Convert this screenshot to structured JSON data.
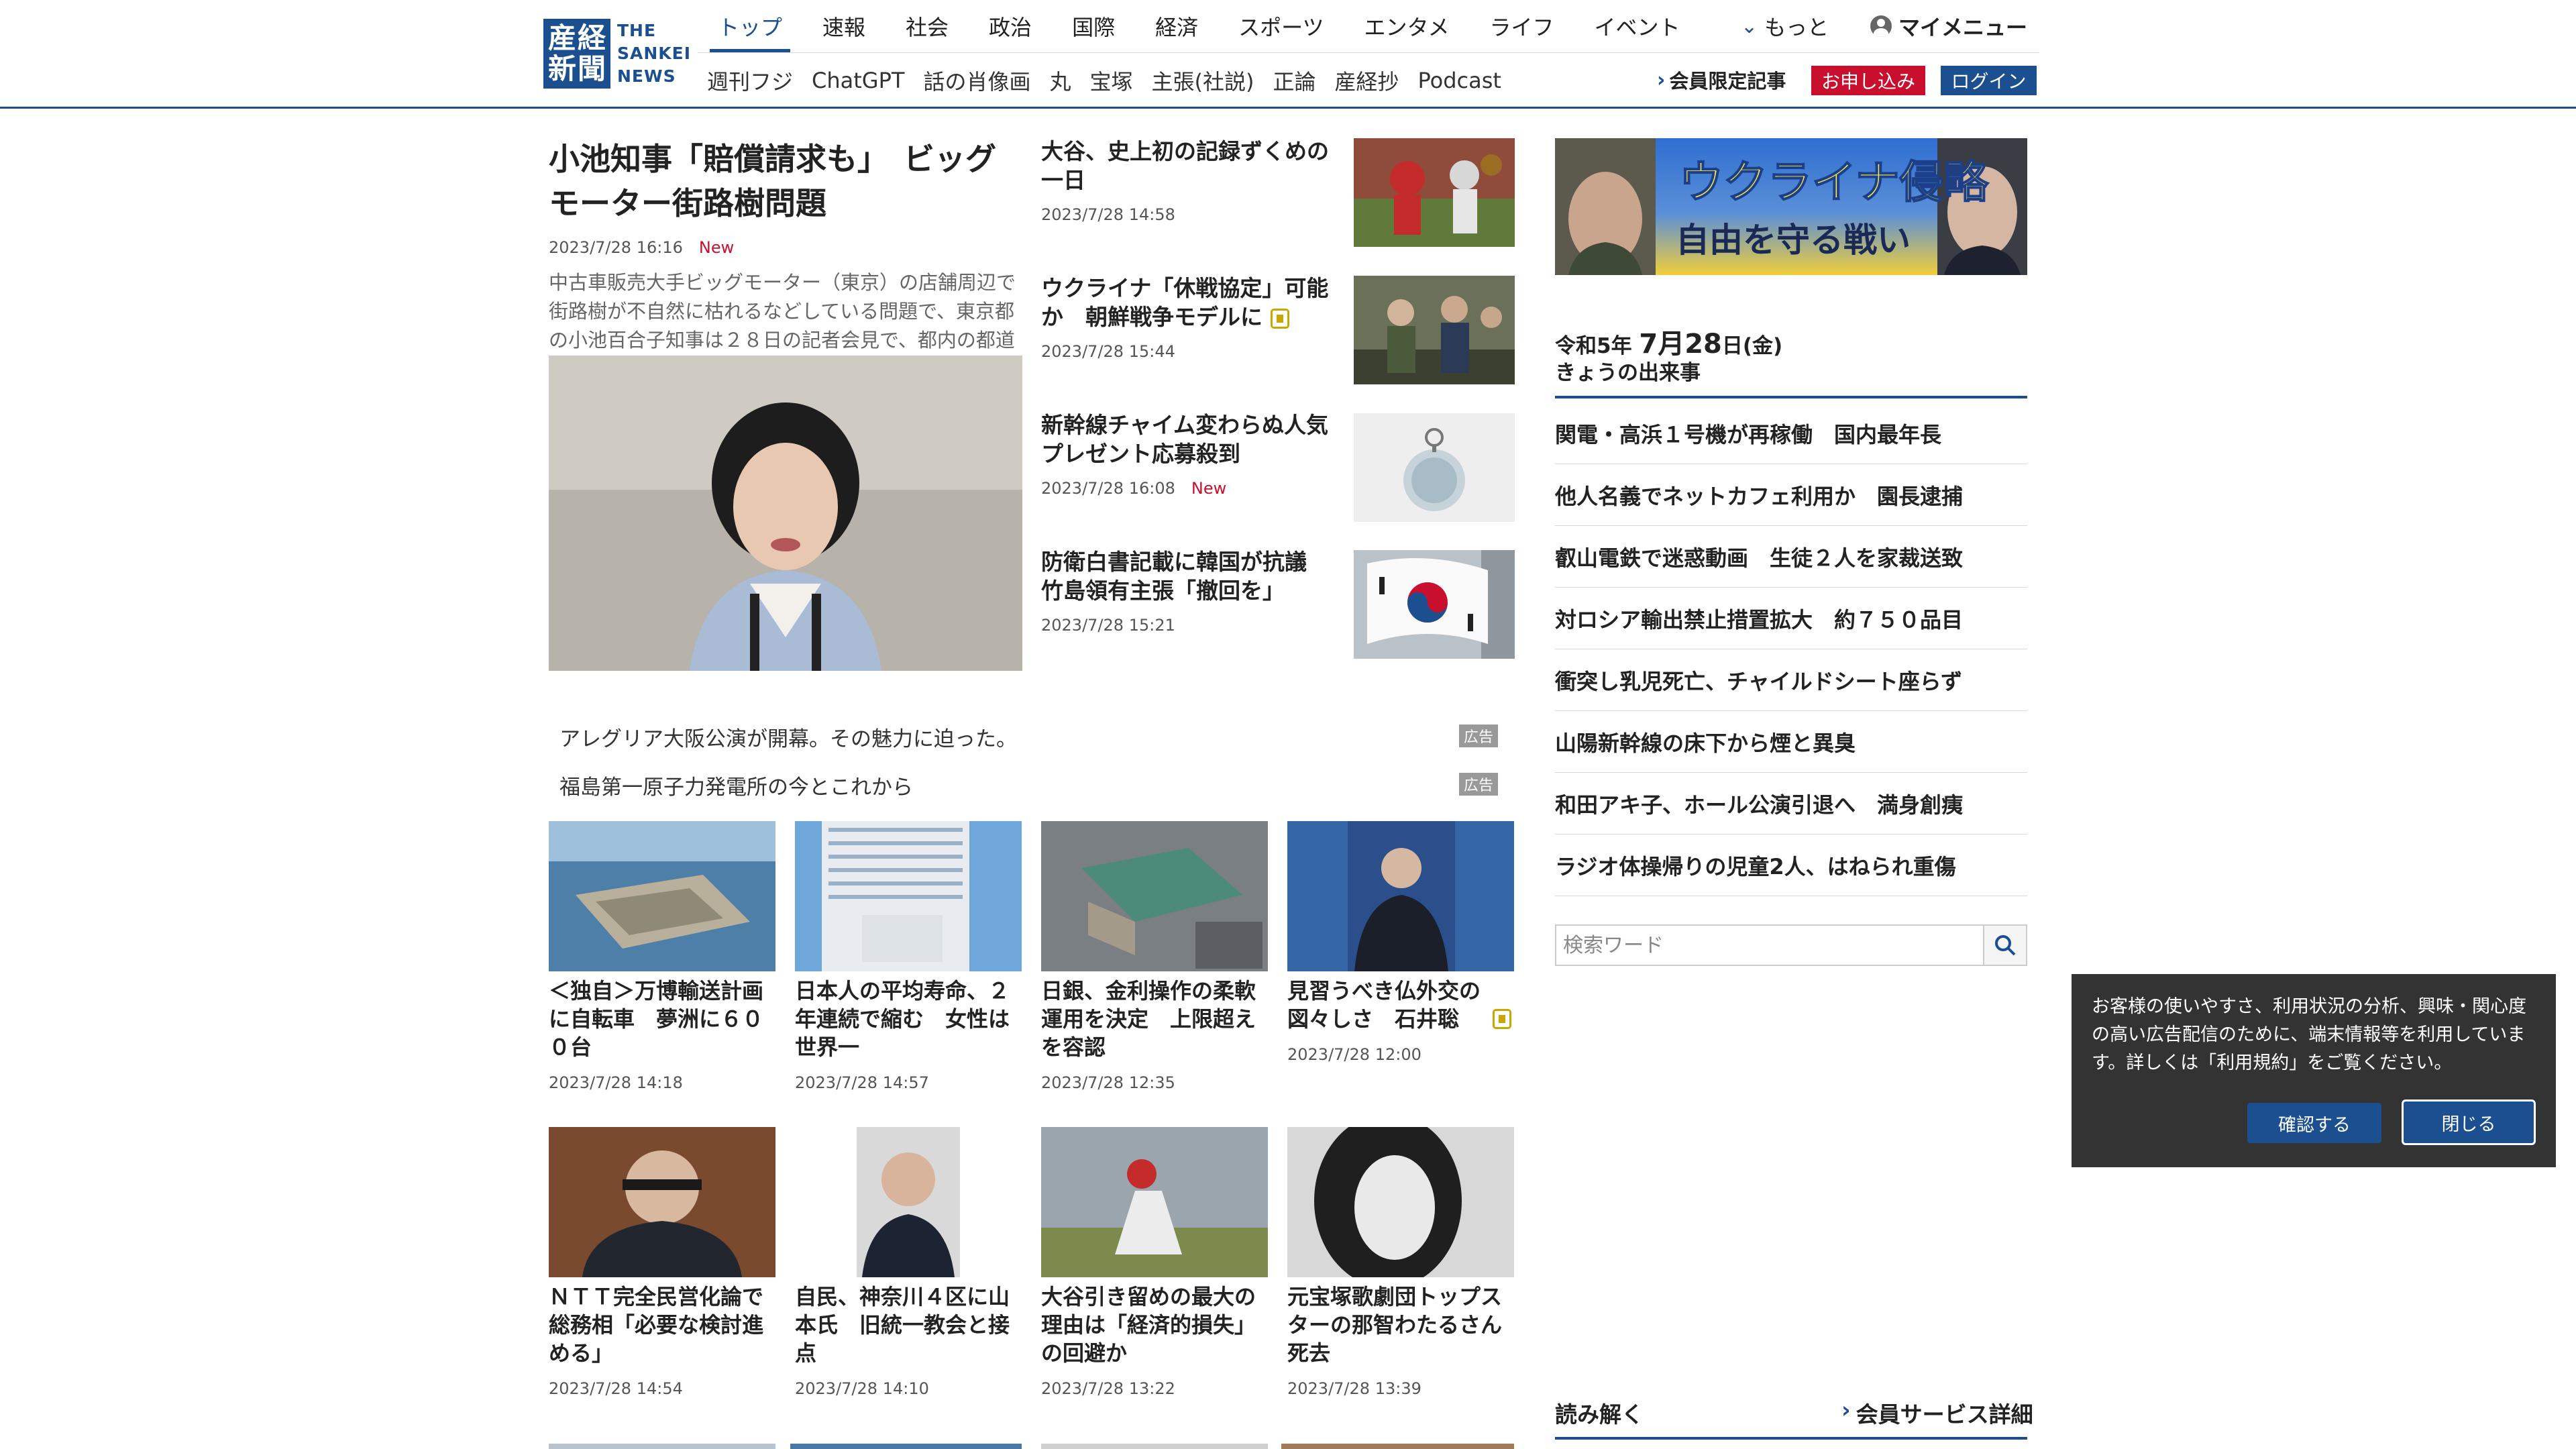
{
  "logo": {
    "kanji": [
      "産",
      "経",
      "新",
      "聞"
    ],
    "word": [
      "THE",
      "SANKEI",
      "NEWS"
    ]
  },
  "nav": {
    "tabs": [
      "トップ",
      "速報",
      "社会",
      "政治",
      "国際",
      "経済",
      "スポーツ",
      "エンタメ",
      "ライフ",
      "イベント"
    ],
    "more": "もっと",
    "mymenu": "マイメニュー"
  },
  "subnav": {
    "items": [
      "週刊フジ",
      "ChatGPT",
      "話の肖像画",
      "丸",
      "宝塚",
      "主張(社説)",
      "正論",
      "産経抄",
      "Podcast"
    ],
    "member_link": "会員限定記事",
    "apply": "お申し込み",
    "login": "ログイン"
  },
  "lead": {
    "title": "小池知事「賠償請求も」　ビッグモーター街路樹問題",
    "date": "2023/7/28 16:16",
    "new": "New",
    "summary": "中古車販売大手ビッグモーター（東京）の店舗周辺で街路樹が不自然に枯れるなどしている問題で、東京都の小池百合子知事は２８日の記者会見で、都内の都道沿..."
  },
  "side": [
    {
      "title": "大谷、史上初の記録ずくめの一日",
      "date": "2023/7/28 14:58",
      "new": "",
      "locked": false
    },
    {
      "title": "ウクライナ「休戦協定」可能か　朝鮮戦争モデルに",
      "date": "2023/7/28 15:44",
      "new": "",
      "locked": true
    },
    {
      "title": "新幹線チャイム変わらぬ人気　プレゼント応募殺到",
      "date": "2023/7/28 16:08",
      "new": "New",
      "locked": false
    },
    {
      "title": "防衛白書記載に韓国が抗議　竹島領有主張「撤回を」",
      "date": "2023/7/28 15:21",
      "new": "",
      "locked": false
    }
  ],
  "ads": [
    {
      "text": "アレグリア大阪公演が開幕。その魅力に迫った。",
      "badge": "広告"
    },
    {
      "text": "福島第一原子力発電所の今とこれから",
      "badge": "広告"
    }
  ],
  "grid1": [
    {
      "title": "＜独自＞万博輸送計画に自転車　夢洲に６００台",
      "date": "2023/7/28 14:18",
      "locked": false
    },
    {
      "title": "日本人の平均寿命、２年連続で縮む　女性は世界一",
      "date": "2023/7/28 14:57",
      "locked": false
    },
    {
      "title": "日銀、金利操作の柔軟運用を決定　上限超えを容認",
      "date": "2023/7/28 12:35",
      "locked": false
    },
    {
      "title": "見習うべき仏外交の図々しさ　石井聡",
      "date": "2023/7/28 12:00",
      "locked": true
    }
  ],
  "grid2": [
    {
      "title": "ＮＴＴ完全民営化論で総務相「必要な検討進める」",
      "date": "2023/7/28 14:54",
      "locked": false
    },
    {
      "title": "自民、神奈川４区に山本氏　旧統一教会と接点",
      "date": "2023/7/28 14:10",
      "locked": false
    },
    {
      "title": "大谷引き留めの最大の理由は「経済的損失」の回避か",
      "date": "2023/7/28 13:22",
      "locked": false
    },
    {
      "title": "元宝塚歌劇団トップスターの那智わたるさん死去",
      "date": "2023/7/28 13:39",
      "locked": false
    }
  ],
  "right": {
    "banner_text": "ウクライナ侵略",
    "banner_sub": "自由を守る戦い",
    "date_pre": "令和5年",
    "date_month": "7月",
    "date_day": "28",
    "date_post": "日(金)",
    "today_label": "きょうの出来事",
    "today": [
      "関電・高浜１号機が再稼働　国内最年長",
      "他人名義でネットカフェ利用か　園長逮捕",
      "叡山電鉄で迷惑動画　生徒２人を家裁送致",
      "対ロシア輸出禁止措置拡大　約７５０品目",
      "衝突し乳児死亡、チャイルドシート座らず",
      "山陽新幹線の床下から煙と異臭",
      "和田アキ子、ホール公演引退へ　満身創痍",
      "ラジオ体操帰りの児童2人、はねられ重傷"
    ],
    "search_placeholder": "検索ワード",
    "yomitoku": "読み解く",
    "member_service": "会員サービス詳細"
  },
  "cookie": {
    "text": "お客様の使いやすさ、利用状況の分析、興味・関心度の高い広告配信のために、端末情報等を利用しています。詳しくは「利用規約」をご覧ください。",
    "confirm": "確認する",
    "close": "閉じる"
  }
}
